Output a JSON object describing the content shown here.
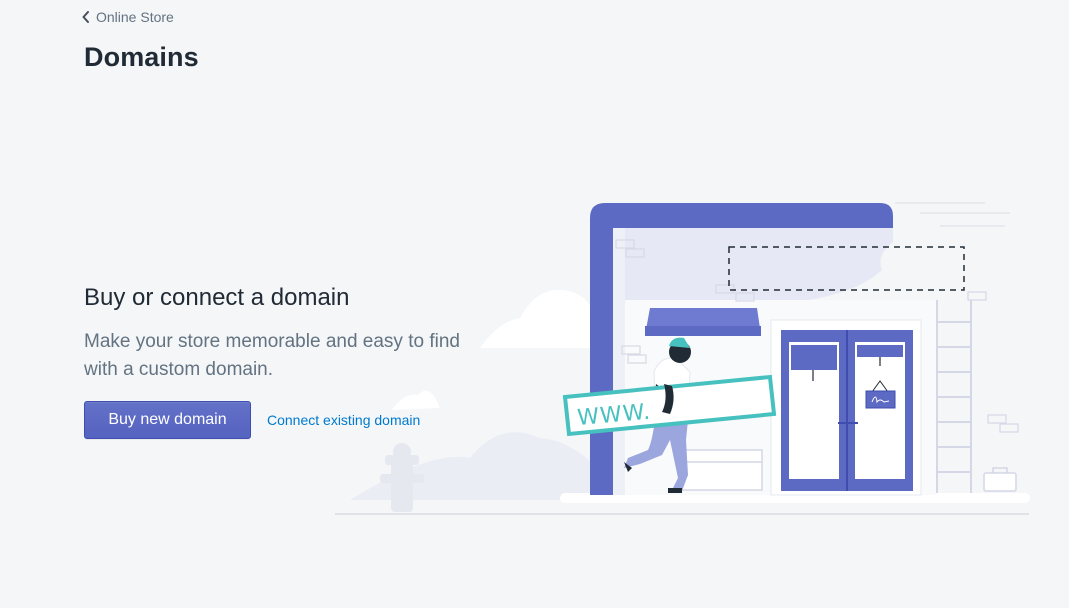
{
  "breadcrumb": {
    "label": "Online Store",
    "icon": "chevron-left-icon"
  },
  "page": {
    "title": "Domains"
  },
  "empty_state": {
    "heading": "Buy or connect a domain",
    "description": "Make your store memorable and easy to find with a custom domain.",
    "primary_action": "Buy new domain",
    "secondary_action": "Connect existing domain",
    "illustration_text": "WWW."
  },
  "colors": {
    "background": "#f4f6f8",
    "primary": "#5c6ac4",
    "link": "#007ace",
    "teal": "#47c1bf",
    "text_subdued": "#637381"
  }
}
